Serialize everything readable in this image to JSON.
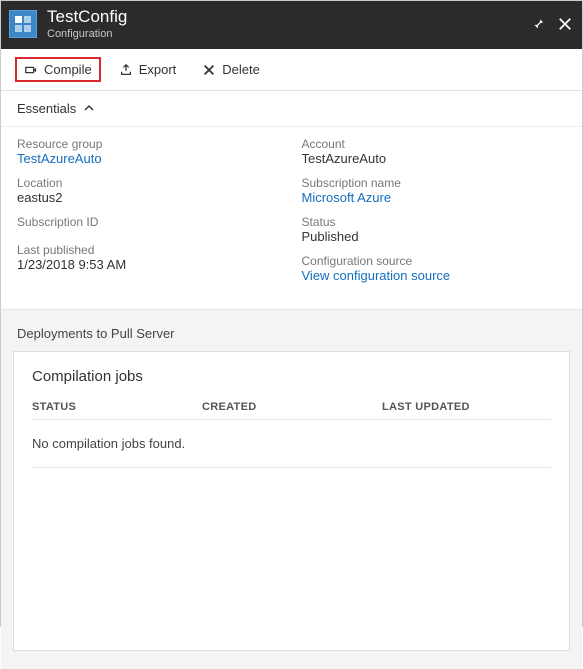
{
  "header": {
    "title": "TestConfig",
    "subtitle": "Configuration"
  },
  "toolbar": {
    "compile": "Compile",
    "export": "Export",
    "delete": "Delete"
  },
  "essentials": {
    "toggle_label": "Essentials",
    "left": {
      "resource_group_label": "Resource group",
      "resource_group_value": "TestAzureAuto",
      "location_label": "Location",
      "location_value": "eastus2",
      "subscription_id_label": "Subscription ID",
      "subscription_id_value": "",
      "last_published_label": "Last published",
      "last_published_value": "1/23/2018 9:53 AM"
    },
    "right": {
      "account_label": "Account",
      "account_value": "TestAzureAuto",
      "subscription_name_label": "Subscription name",
      "subscription_name_value": "Microsoft Azure",
      "status_label": "Status",
      "status_value": "Published",
      "config_source_label": "Configuration source",
      "config_source_value": "View configuration source"
    }
  },
  "deployments": {
    "section_title": "Deployments to Pull Server",
    "card_title": "Compilation jobs",
    "columns": {
      "status": "STATUS",
      "created": "CREATED",
      "updated": "LAST UPDATED"
    },
    "empty_message": "No compilation jobs found."
  }
}
